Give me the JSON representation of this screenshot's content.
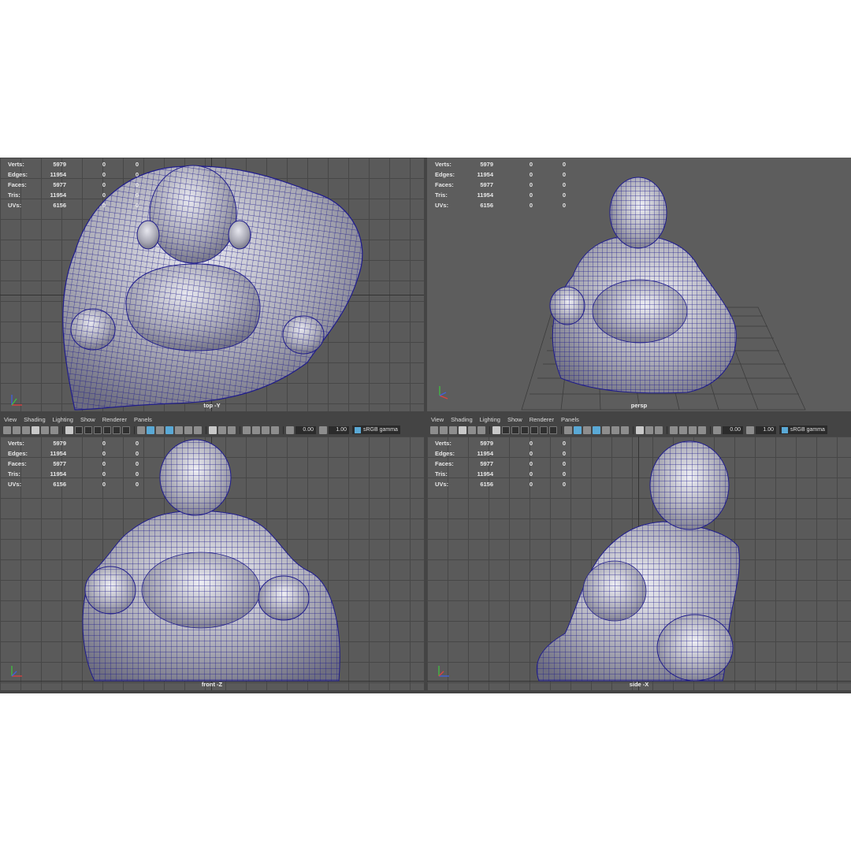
{
  "stats": {
    "labels": {
      "verts": "Verts:",
      "edges": "Edges:",
      "faces": "Faces:",
      "tris": "Tris:",
      "uvs": "UVs:"
    },
    "values": {
      "verts": "5979",
      "edges": "11954",
      "faces": "5977",
      "tris": "11954",
      "uvs": "6156"
    },
    "zero": "0"
  },
  "viewports": {
    "top": {
      "camera": "top -Y"
    },
    "persp": {
      "camera": "persp"
    },
    "front": {
      "camera": "front -Z"
    },
    "side": {
      "camera": "side -X"
    }
  },
  "panel_menu": {
    "view": "View",
    "shading": "Shading",
    "lighting": "Lighting",
    "show": "Show",
    "renderer": "Renderer",
    "panels": "Panels"
  },
  "toolbar": {
    "exposure": "0.00",
    "gamma": "1.00",
    "color_space": "sRGB gamma"
  },
  "icons": {
    "camera": "camera-icon",
    "wireframe": "wireframe-icon",
    "smooth": "smooth-shade-icon",
    "xray": "xray-icon",
    "grid": "grid-icon",
    "light": "light-icon",
    "exposure": "exposure-icon",
    "gamma": "gamma-icon",
    "axis": "axis-gizmo-icon"
  },
  "colors": {
    "viewport_bg": "#5a5a5a",
    "grid_line": "#474747",
    "wire": "#1f1c8c",
    "mesh": "#b3b3bd",
    "accent": "#5aa9d6"
  }
}
